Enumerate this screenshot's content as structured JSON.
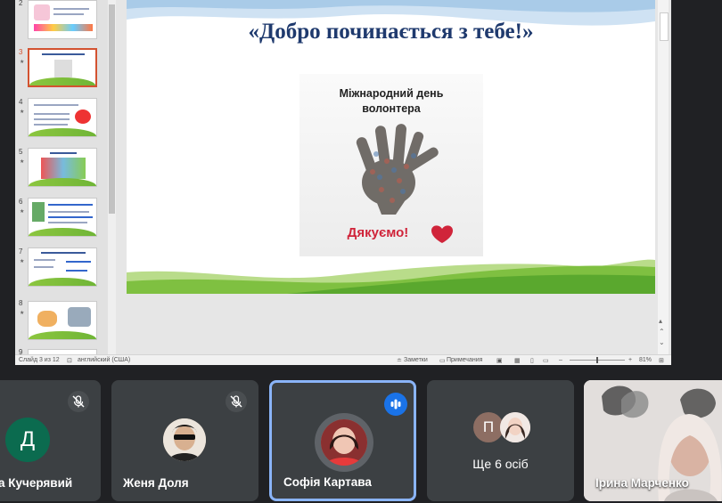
{
  "slide": {
    "title": "«Добро починається з тебе!»",
    "poster_heading_line1": "Міжнародний день",
    "poster_heading_line2": "волонтера",
    "poster_footer": "Дякуємо!"
  },
  "thumbnails": [
    {
      "num": "2"
    },
    {
      "num": "3"
    },
    {
      "num": "4"
    },
    {
      "num": "5"
    },
    {
      "num": "6"
    },
    {
      "num": "7"
    },
    {
      "num": "8"
    },
    {
      "num": "9"
    }
  ],
  "status": {
    "slide_count": "Слайд 3 из 12",
    "language": "английский (США)",
    "notes": "Заметки",
    "comments": "Примечания",
    "zoom": "81%"
  },
  "participants": [
    {
      "name": "а Кучерявий",
      "initial": "Д",
      "avatar_color": "#0b6b4f"
    },
    {
      "name": "Женя Доля"
    },
    {
      "name": "Софія Картава",
      "speaking": true
    },
    {
      "name": "Ще 6 осіб",
      "initial": "П"
    },
    {
      "name": "Ірина Марченко"
    }
  ],
  "colors": {
    "accent": "#8ab4f8",
    "speaking_badge": "#1a73e8"
  }
}
